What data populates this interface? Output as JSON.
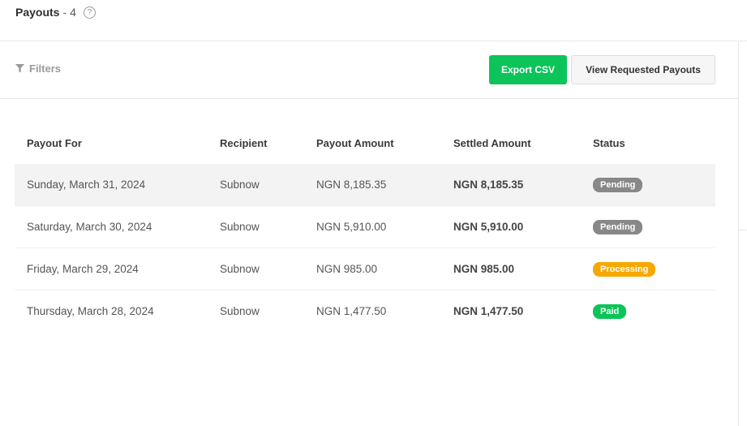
{
  "header": {
    "title": "Payouts",
    "separator": "-",
    "count": "4",
    "help_symbol": "?"
  },
  "toolbar": {
    "filters_label": "Filters",
    "export_label": "Export CSV",
    "view_requested_label": "View Requested Payouts"
  },
  "colors": {
    "accent_green": "#0cc45a",
    "pending": "#888888",
    "processing": "#f7a800",
    "paid": "#0cc45a"
  },
  "table": {
    "columns": [
      "Payout For",
      "Recipient",
      "Payout Amount",
      "Settled Amount",
      "Status"
    ],
    "rows": [
      {
        "date": "Sunday, March 31, 2024",
        "recipient": "Subnow",
        "payout_amount": "NGN 8,185.35",
        "settled_amount": "NGN 8,185.35",
        "status": "Pending"
      },
      {
        "date": "Saturday, March 30, 2024",
        "recipient": "Subnow",
        "payout_amount": "NGN 5,910.00",
        "settled_amount": "NGN 5,910.00",
        "status": "Pending"
      },
      {
        "date": "Friday, March 29, 2024",
        "recipient": "Subnow",
        "payout_amount": "NGN 985.00",
        "settled_amount": "NGN 985.00",
        "status": "Processing"
      },
      {
        "date": "Thursday, March 28, 2024",
        "recipient": "Subnow",
        "payout_amount": "NGN 1,477.50",
        "settled_amount": "NGN 1,477.50",
        "status": "Paid"
      }
    ]
  }
}
